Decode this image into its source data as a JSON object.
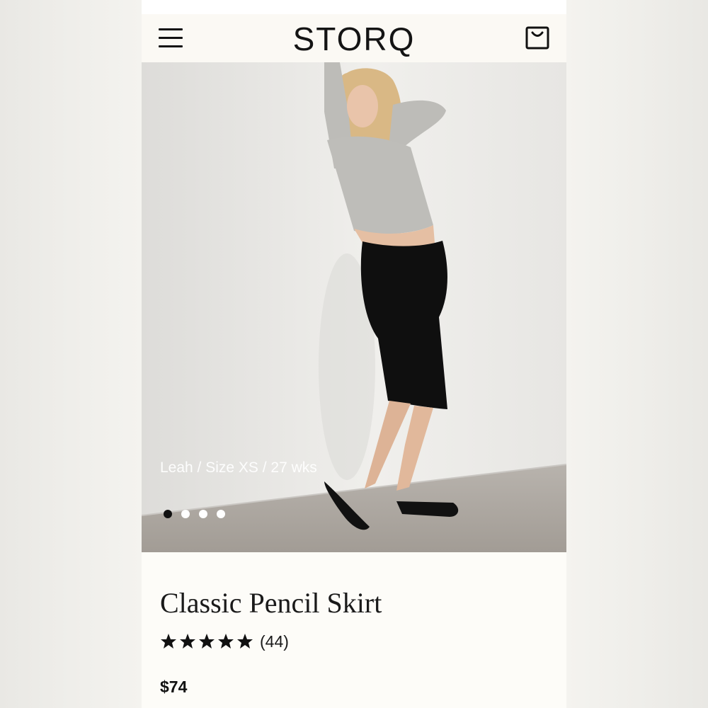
{
  "header": {
    "brand": "STORQ",
    "menu_icon": "hamburger-menu-icon",
    "cart_icon": "shopping-bag-icon"
  },
  "hero": {
    "caption": "Leah / Size XS / 27 wks",
    "carousel": {
      "total_slides": 4,
      "active_slide": 1
    }
  },
  "product": {
    "title": "Classic Pencil Skirt",
    "rating": {
      "stars": 5,
      "review_count": "(44)"
    },
    "price": "$74"
  },
  "colors": {
    "page_bg": "#fdfcf8",
    "header_bg": "#fbf9f4",
    "text": "#1a1a1a",
    "dot_active": "#111111",
    "dot_inactive": "#ffffff"
  }
}
